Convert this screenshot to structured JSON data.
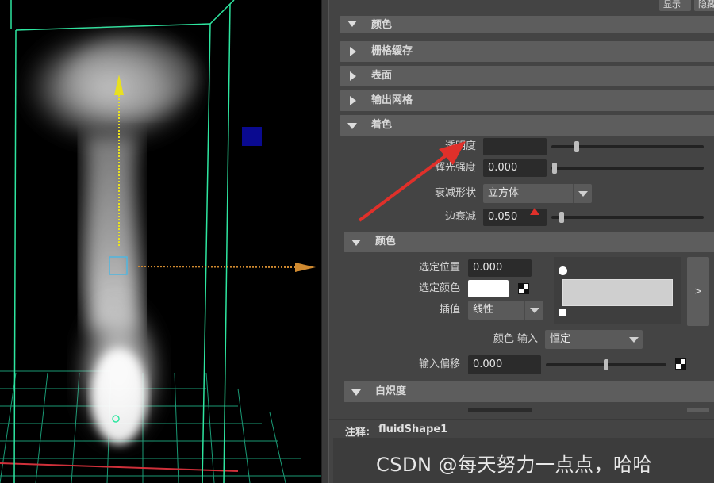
{
  "toolbar": {
    "display_label": "显示",
    "hide_label": "隐藏"
  },
  "sections": {
    "color_top": "颜色",
    "grid_cache": "栅格缓存",
    "surface": "表面",
    "output_mesh": "输出网格",
    "shading": "着色",
    "color": "颜色",
    "incandescence": "白炽度"
  },
  "shading": {
    "transparency_label": "透明度",
    "glow_label": "辉光强度",
    "glow_value": "0.000",
    "dropoff_shape_label": "衰减形状",
    "dropoff_shape_value": "立方体",
    "edge_dropoff_label": "边衰减",
    "edge_dropoff_value": "0.050"
  },
  "color": {
    "selected_position_label": "选定位置",
    "selected_position_value": "0.000",
    "selected_color_label": "选定颜色",
    "interpolation_label": "插值",
    "interpolation_value": "线性",
    "color_input_label": "颜色 输入",
    "color_input_value": "恒定",
    "input_bias_label": "输入偏移",
    "input_bias_value": "0.000",
    "expand_glyph": ">"
  },
  "status": {
    "notes_label": "注释:",
    "notes_value": "fluidShape1"
  },
  "watermark": "CSDN @每天努力一点点，哈哈",
  "colors": {
    "panel_bg": "#444444",
    "section_bg": "#5d5d5d",
    "field_bg": "#2b2b2b",
    "annotation_arrow": "#e0302a",
    "wireframe": "#2ee6a0",
    "manipulator_y": "#e8e020",
    "manipulator_x": "#d08a30"
  }
}
